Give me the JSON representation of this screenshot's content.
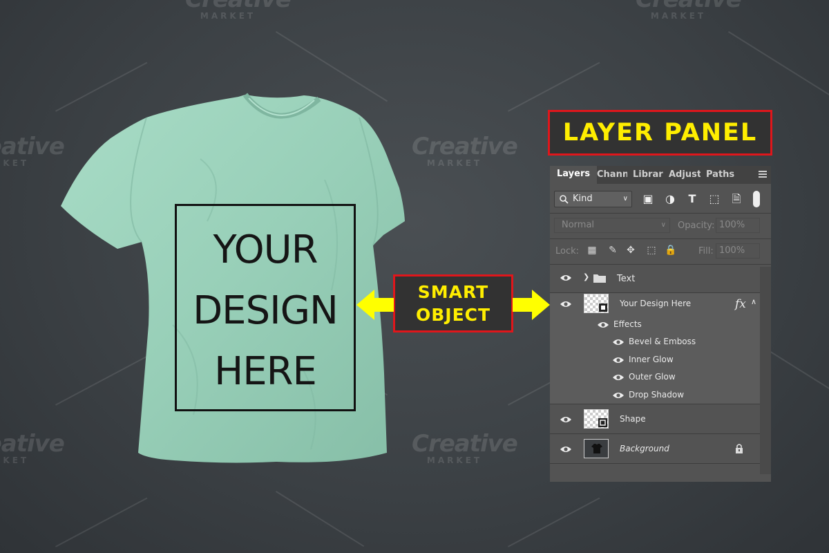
{
  "watermark": {
    "line1": "Creative",
    "line2": "MARKET"
  },
  "mockup": {
    "design_lines": [
      "YOUR",
      "DESIGN",
      "HERE"
    ]
  },
  "callouts": {
    "layer_panel": "LAYER PANEL",
    "smart_object": [
      "SMART",
      "OBJECT"
    ]
  },
  "colors": {
    "callout_border": "#e0161b",
    "callout_text": "#ffee00",
    "arrow": "#ffff00",
    "shirt": "#9cd4bd",
    "panel_bg": "#535353"
  },
  "panel": {
    "tabs": [
      "Layers",
      "Channe",
      "Librarie",
      "Adjustı",
      "Paths"
    ],
    "filter": {
      "kind_label": "Kind",
      "icons": [
        "image-filter-icon",
        "adjustment-filter-icon",
        "type-filter-icon",
        "shape-filter-icon",
        "smart-object-filter-icon"
      ]
    },
    "blend_mode": "Normal",
    "opacity_label": "Opacity:",
    "opacity_value": "100%",
    "lock_label": "Lock:",
    "fill_label": "Fill:",
    "fill_value": "100%",
    "layers": [
      {
        "name": "Text",
        "type": "group"
      },
      {
        "name": "Your Design Here",
        "type": "smart-object",
        "fx": "fx",
        "selected": true
      },
      {
        "name": "Effects",
        "type": "effects-header"
      },
      {
        "name": "Bevel & Emboss",
        "type": "effect"
      },
      {
        "name": "Inner Glow",
        "type": "effect"
      },
      {
        "name": "Outer Glow",
        "type": "effect"
      },
      {
        "name": "Drop Shadow",
        "type": "effect"
      },
      {
        "name": "Shape",
        "type": "shape"
      },
      {
        "name": "Background",
        "type": "background",
        "locked": true
      }
    ]
  }
}
